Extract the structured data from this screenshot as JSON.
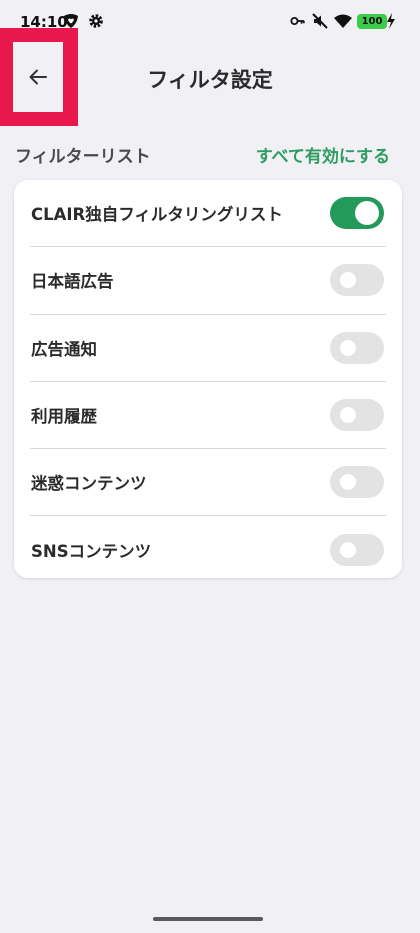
{
  "status_bar": {
    "time": "14:10",
    "battery": "100",
    "icons": [
      "shield-heart-icon",
      "gear-icon",
      "key-icon",
      "mute-icon",
      "wifi-icon",
      "battery-icon"
    ]
  },
  "header": {
    "back_icon": "arrow-left-icon",
    "title": "フィルタ設定"
  },
  "section": {
    "label": "フィルターリスト",
    "enable_all": "すべて有効にする"
  },
  "filters": [
    {
      "label": "CLAIR独自フィルタリングリスト",
      "enabled": true
    },
    {
      "label": "日本語広告",
      "enabled": false
    },
    {
      "label": "広告通知",
      "enabled": false
    },
    {
      "label": "利用履歴",
      "enabled": false
    },
    {
      "label": "迷惑コンテンツ",
      "enabled": false
    },
    {
      "label": "SNSコンテンツ",
      "enabled": false
    }
  ],
  "colors": {
    "accent": "#2e9d62",
    "toggle_on": "#239a5a",
    "toggle_off": "#e3e3e3",
    "highlight": "#e8184f",
    "background": "#f1f0f5"
  }
}
